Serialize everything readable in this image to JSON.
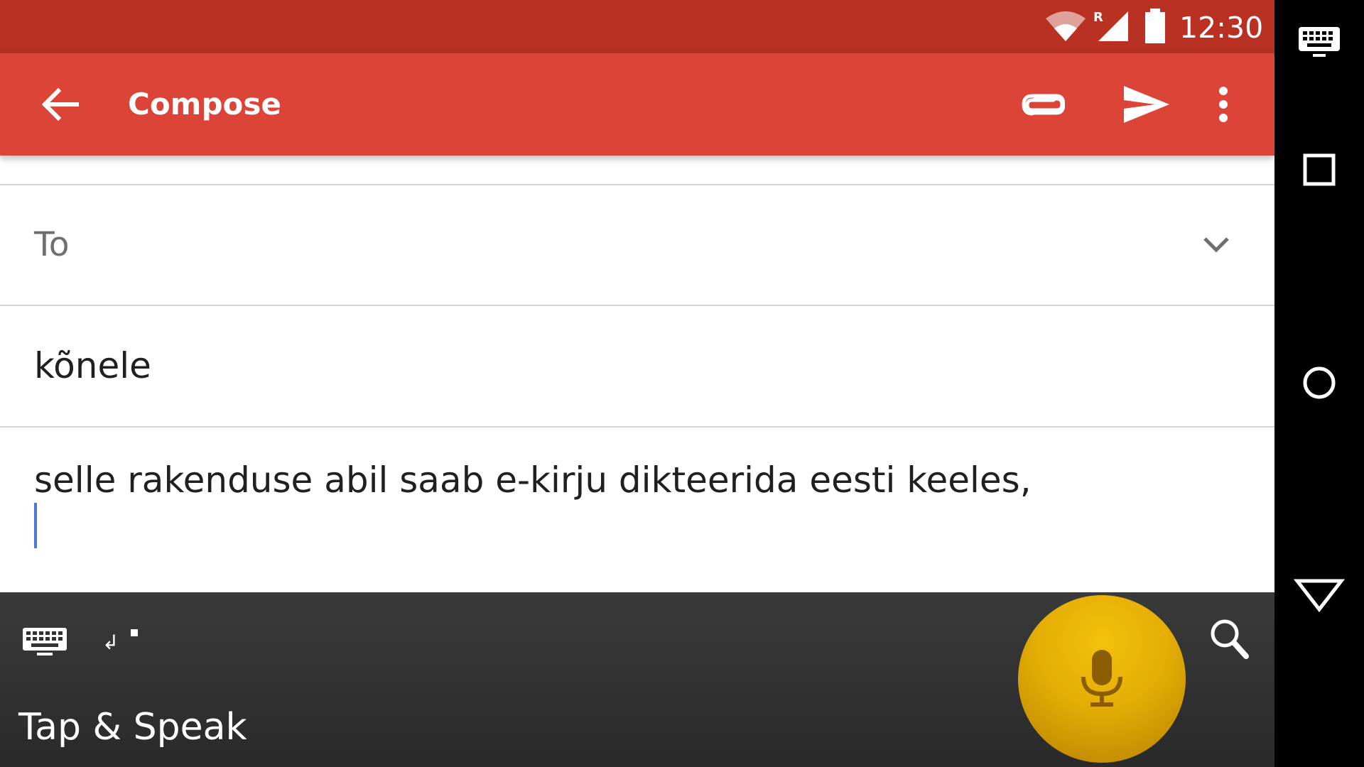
{
  "status_bar": {
    "time": "12:30",
    "roaming_indicator": "R",
    "icons": [
      "wifi-icon",
      "signal-icon",
      "battery-icon"
    ]
  },
  "app_bar": {
    "title": "Compose",
    "actions": [
      "back-arrow-icon",
      "paperclip-icon",
      "send-icon",
      "more-vertical-icon"
    ]
  },
  "compose": {
    "to_label": "To",
    "subject": "kõnele",
    "body": "selle rakenduse abil saab e-kirju dikteerida eesti keeles,"
  },
  "speech_keyboard": {
    "label": "Tap & Speak",
    "newline_symbol": "↲",
    "icons": [
      "keyboard-icon",
      "newline-icon",
      "microphone-icon",
      "search-icon"
    ]
  },
  "navigation_bar": {
    "icons": [
      "keyboard-switch-icon",
      "recents-icon",
      "home-icon",
      "back-icon"
    ]
  },
  "colors": {
    "status_bar": "#b93122",
    "app_bar": "#db4437",
    "keyboard_background": "#2f2f2f",
    "mic_button": "#e3ad05",
    "cursor": "#4a7bd4",
    "nav_bar": "#000000"
  }
}
